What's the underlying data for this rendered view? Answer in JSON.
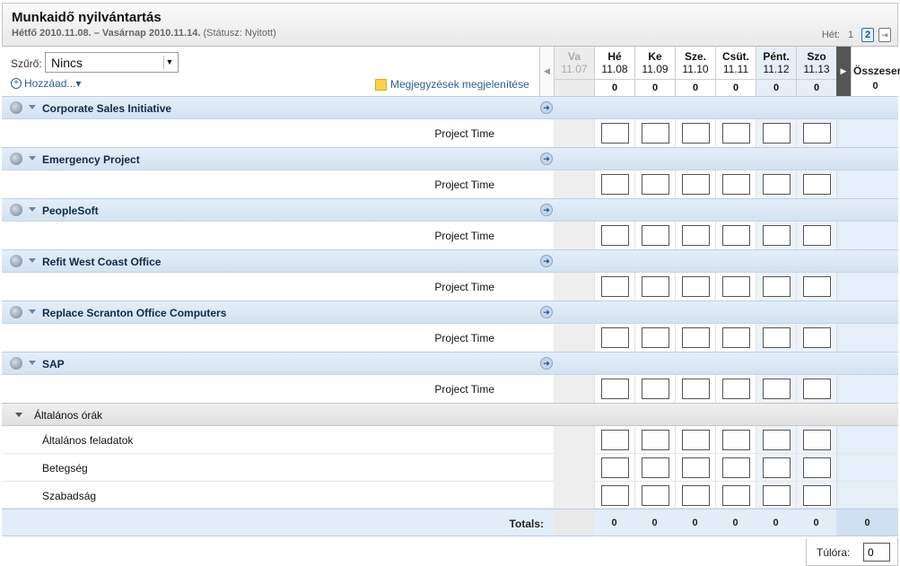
{
  "header": {
    "title": "Munkaidő nyilvántartás",
    "date_range": "Hétfő 2010.11.08. – Vasárnap 2010.11.14.",
    "status": "(Státusz: Nyitott)",
    "week_label": "Hét:",
    "week_pages": [
      "1",
      "2"
    ],
    "week_last": "⇥"
  },
  "toolbar": {
    "filter_label": "Szűrő:",
    "filter_value": "Nincs",
    "add_label": "Hozzáad...▾",
    "notes_label": "Megjegyzések megjelenítése"
  },
  "days": [
    {
      "name": "Va",
      "date": "11.07",
      "total": ""
    },
    {
      "name": "Hé",
      "date": "11.08",
      "total": "0"
    },
    {
      "name": "Ke",
      "date": "11.09",
      "total": "0"
    },
    {
      "name": "Sze.",
      "date": "11.10",
      "total": "0"
    },
    {
      "name": "Csüt.",
      "date": "11.11",
      "total": "0"
    },
    {
      "name": "Pént.",
      "date": "11.12",
      "total": "0"
    },
    {
      "name": "Szo",
      "date": "11.13",
      "total": "0"
    }
  ],
  "summary": {
    "label": "Összesen",
    "value": "0"
  },
  "projects": [
    {
      "name": "Corporate Sales Initiative",
      "task": "Project Time"
    },
    {
      "name": "Emergency Project",
      "task": "Project Time"
    },
    {
      "name": "PeopleSoft",
      "task": "Project Time"
    },
    {
      "name": "Refit West Coast Office",
      "task": "Project Time"
    },
    {
      "name": "Replace Scranton Office Computers",
      "task": "Project Time"
    },
    {
      "name": "SAP",
      "task": "Project Time"
    }
  ],
  "general": {
    "title": "Általános órák",
    "items": [
      "Általános feladatok",
      "Betegség",
      "Szabadság"
    ]
  },
  "totals": {
    "label": "Totals:",
    "values": [
      "0",
      "0",
      "0",
      "0",
      "0",
      "0"
    ],
    "sum": "0"
  },
  "overtime": {
    "label": "Túlóra:",
    "value": "0"
  }
}
